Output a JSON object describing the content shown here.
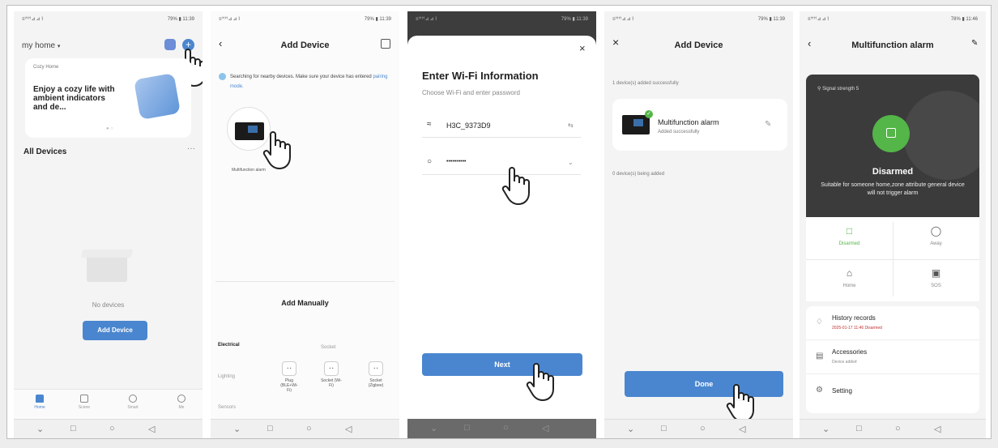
{
  "status": {
    "left": "≡ᴴᴴ⊿⊿⌇",
    "right_1": "79% ▮ 11:39",
    "right_5": "78% ▮ 11:46"
  },
  "screen1": {
    "home_name": "my home",
    "card_caption": "Cozy Home",
    "card_text": "Enjoy a cozy life with ambient indicators and de...",
    "all_devices": "All Devices",
    "more": "···",
    "no_devices": "No devices",
    "add_button": "Add Device",
    "tabs": [
      {
        "label": "Home"
      },
      {
        "label": "Scene"
      },
      {
        "label": "Smart"
      },
      {
        "label": "Me"
      }
    ]
  },
  "screen2": {
    "title": "Add Device",
    "search_text": "Searching for nearby devices. Make sure your device has entered",
    "pairing_link": "pairing mode.",
    "device_label": "Multifunction alarm",
    "manual_title": "Add Manually",
    "cat_electrical": "Electrical",
    "cat_lighting": "Lighting",
    "cat_sensors": "Sensors",
    "socket_header": "Socket",
    "items": [
      {
        "name": "Plug (BLE+Wi-Fi)"
      },
      {
        "name": "Socket (Wi-Fi)"
      },
      {
        "name": "Socket (Zigbee)"
      }
    ]
  },
  "screen3": {
    "title": "Enter Wi-Fi Information",
    "subtitle": "Choose Wi-Fi and enter password",
    "ssid": "H3C_9373D9",
    "password": "••••••••••",
    "next": "Next"
  },
  "screen4": {
    "title": "Add Device",
    "added_count": "1 device(s) added successfully",
    "device_name": "Multifunction alarm",
    "device_status": "Added successfully",
    "being_added": "0 device(s) being added",
    "done": "Done"
  },
  "screen5": {
    "title": "Multifunction alarm",
    "signal": "Signal strength 5",
    "state": "Disarmed",
    "state_desc": "Suitable for someone home,zone attribute general device will not trigger alarm",
    "modes": [
      {
        "label": "Disarmed"
      },
      {
        "label": "Away"
      },
      {
        "label": "Home"
      },
      {
        "label": "SOS"
      }
    ],
    "history_title": "History records",
    "history_sub": "2025-01-17 11:46 Disarmed",
    "acc_title": "Accessories",
    "acc_sub": "Device added",
    "setting": "Setting"
  },
  "colors": {
    "accent": "#4a86cf",
    "green": "#54b548",
    "red": "#c03030",
    "dark": "#3b3b3b"
  }
}
